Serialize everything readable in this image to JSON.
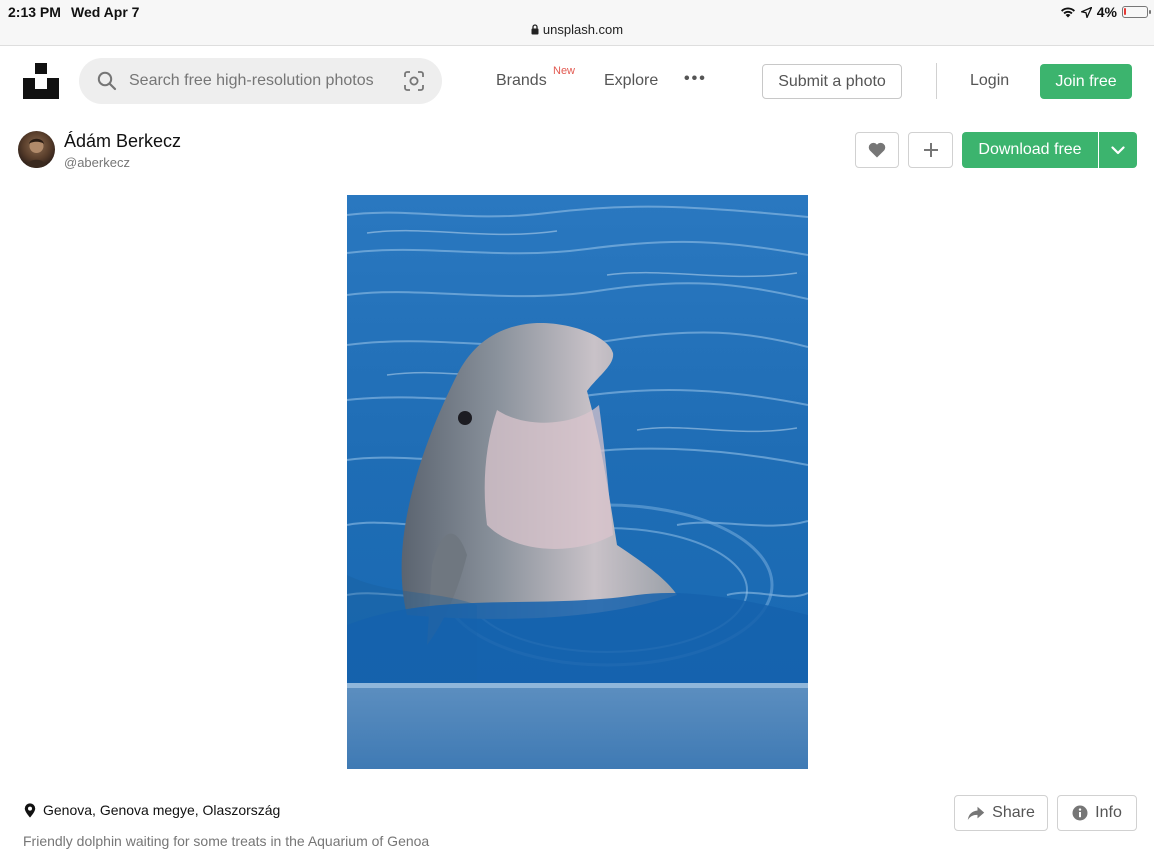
{
  "status_bar": {
    "time": "2:13 PM",
    "date": "Wed Apr 7",
    "battery": "4%",
    "url": "unsplash.com"
  },
  "header": {
    "search_placeholder": "Search free high-resolution photos",
    "nav": {
      "brands": "Brands",
      "brands_badge": "New",
      "explore": "Explore",
      "more": "•••"
    },
    "submit_label": "Submit a photo",
    "login_label": "Login",
    "join_label": "Join free"
  },
  "author": {
    "name": "Ádám Berkecz",
    "handle": "@aberkecz"
  },
  "actions": {
    "download_label": "Download free"
  },
  "photo_info": {
    "location": "Genova, Genova megye, Olaszország",
    "description": "Friendly dolphin waiting for some treats in the Aquarium of Genoa",
    "share_label": "Share",
    "info_label": "Info"
  },
  "colors": {
    "accent_green": "#3cb46e",
    "new_badge": "#e25950"
  }
}
